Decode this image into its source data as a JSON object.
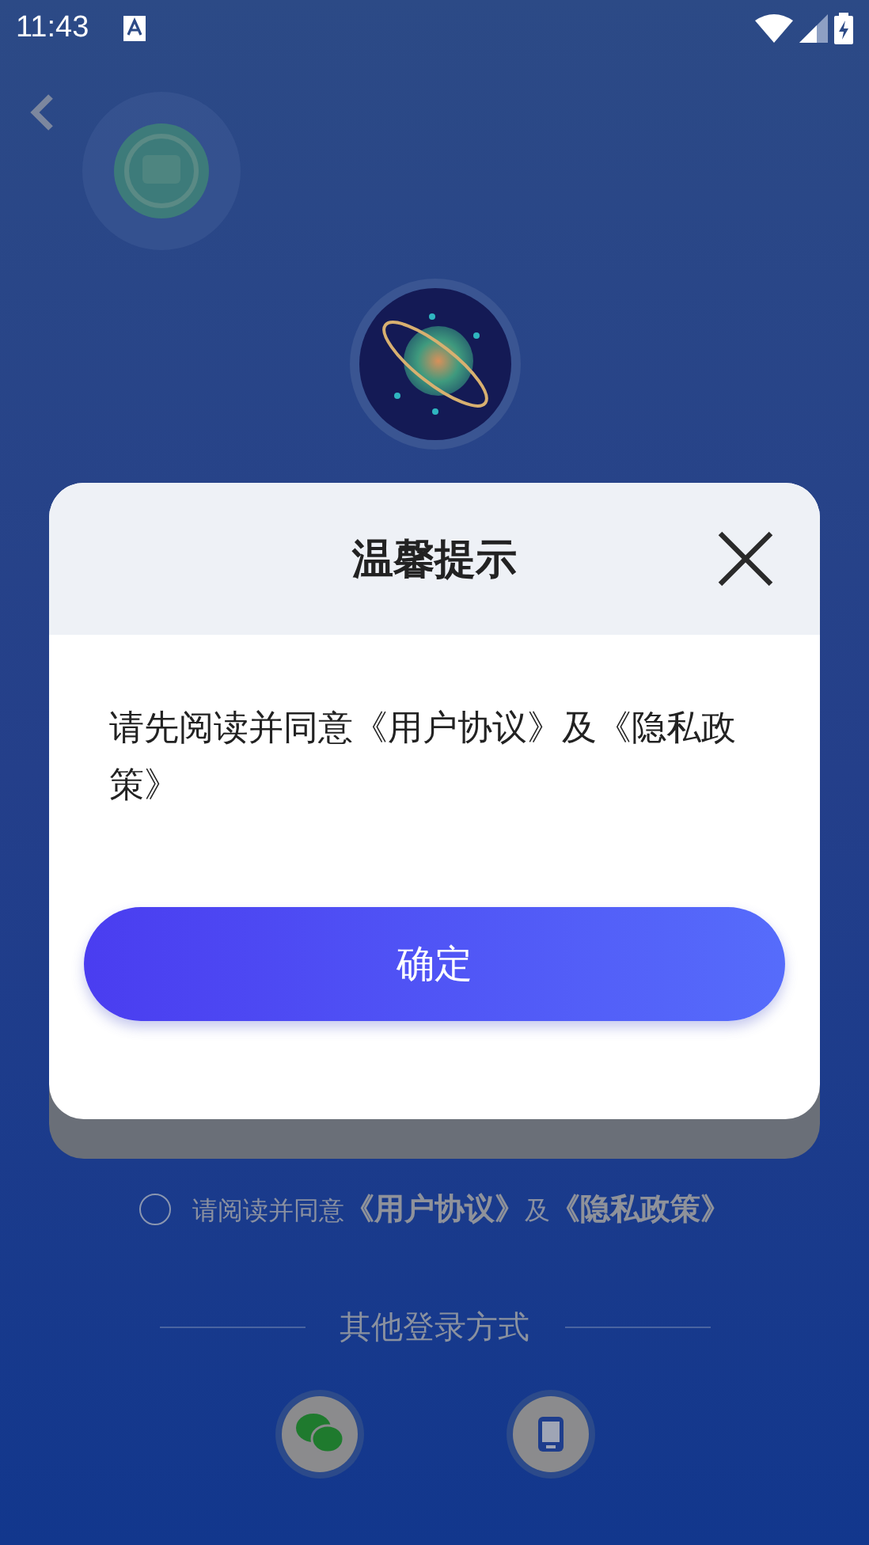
{
  "status_bar": {
    "time": "11:43"
  },
  "agreement": {
    "checked": false,
    "parts": [
      {
        "kind": "text",
        "text": "请阅读并同意"
      },
      {
        "kind": "link",
        "text": "《用户协议》"
      },
      {
        "kind": "text",
        "text": "及"
      },
      {
        "kind": "link",
        "text": "《隐私政策》"
      }
    ]
  },
  "other_login": {
    "label": "其他登录方式"
  },
  "dialog": {
    "title": "温馨提示",
    "message": "请先阅读并同意《用户协议》及《隐私政策》",
    "confirm": "确定"
  }
}
